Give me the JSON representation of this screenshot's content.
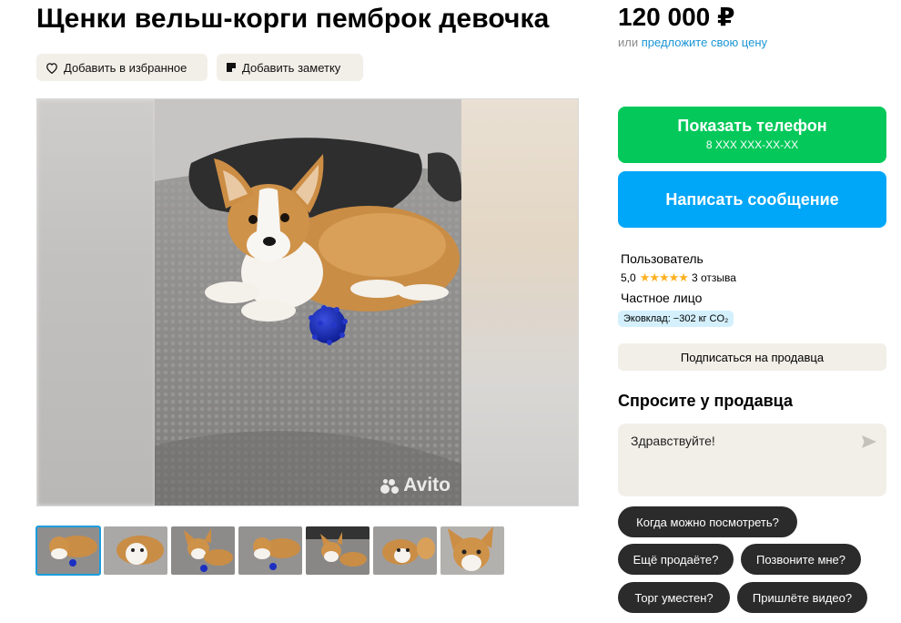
{
  "listing": {
    "title": "Щенки вельш-корги пемброк девочка",
    "favorite_label": "Добавить в избранное",
    "note_label": "Добавить заметку",
    "watermark": "Avito"
  },
  "price": {
    "value": "120 000 ₽",
    "sub_prefix": "или",
    "sub_link": "предложите свою цену"
  },
  "contact": {
    "phone_label": "Показать телефон",
    "phone_masked": "8 XXX XXX-XX-XX",
    "message_label": "Написать сообщение"
  },
  "seller": {
    "name": "Пользователь",
    "rating": "5,0",
    "stars": "★★★★★",
    "reviews": "3 отзыва",
    "type": "Частное лицо",
    "eco": "Эковклад: −302 кг CO₂",
    "subscribe_label": "Подписаться на продавца"
  },
  "ask": {
    "title": "Спросите у продавца",
    "message_value": "Здравствуйте!",
    "chips": [
      "Когда можно посмотреть?",
      "Ещё продаёте?",
      "Позвоните мне?",
      "Торг уместен?",
      "Пришлёте видео?"
    ]
  },
  "gallery": {
    "thumb_count": 7,
    "active_index": 0
  },
  "colors": {
    "green": "#04c95a",
    "blue": "#00a6f7",
    "link": "#1b95d4",
    "star": "#ffb021",
    "chip": "#2b2b2b",
    "light_bg": "#f2efe8"
  }
}
